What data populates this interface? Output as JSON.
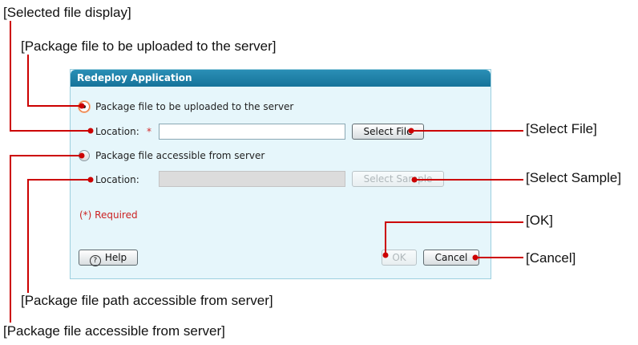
{
  "callouts": {
    "selected_file_display": "[Selected file display]",
    "package_file_upload": "[Package file to be uploaded to the server]",
    "select_file": "[Select File]",
    "select_sample": "[Select Sample]",
    "ok": "[OK]",
    "cancel": "[Cancel]",
    "package_file_path_accessible": "[Package file path accessible from server]",
    "package_file_accessible": "[Package file accessible from server]"
  },
  "dialog": {
    "title": "Redeploy Application",
    "option_upload": {
      "label": "Package file to be uploaded to the server",
      "selected": true
    },
    "location_label_1": "Location:",
    "required_star": "*",
    "location_1_value": "",
    "select_file_button": "Select File",
    "option_server": {
      "label": "Package file accessible from server",
      "selected": false
    },
    "location_label_2": "Location:",
    "location_2_value": "",
    "select_sample_button": "Select Sample",
    "required_note": "(*) Required",
    "help_button": "Help",
    "ok_button": "OK",
    "cancel_button": "Cancel"
  },
  "colors": {
    "callout_line": "#cc0000",
    "title_bar": "#1d80a8",
    "dialog_bg": "#e6f6fb",
    "radio_selected": "#e8743a"
  }
}
